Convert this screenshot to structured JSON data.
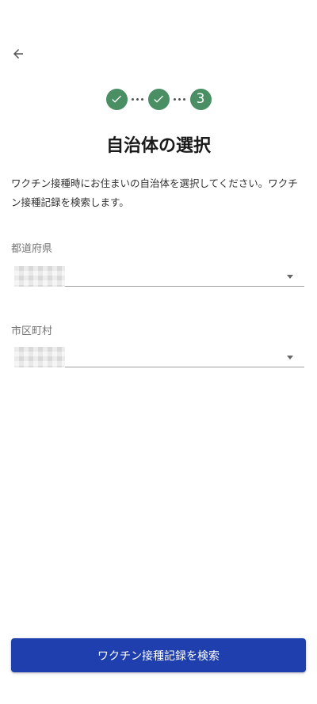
{
  "header": {
    "back_icon": "arrow-left-icon"
  },
  "stepper": {
    "steps": [
      {
        "state": "done",
        "icon": "check-icon"
      },
      {
        "state": "done",
        "icon": "check-icon"
      },
      {
        "state": "current",
        "label": "3"
      }
    ],
    "color": "#4a8e64"
  },
  "title": "自治体の選択",
  "description": "ワクチン接種時にお住まいの自治体を選択してください。ワクチン接種記録を検索します。",
  "form": {
    "prefecture": {
      "label": "都道府県",
      "value": ""
    },
    "municipality": {
      "label": "市区町村",
      "value": ""
    }
  },
  "actions": {
    "search_label": "ワクチン接種記録を検索",
    "color": "#1f3fae"
  }
}
